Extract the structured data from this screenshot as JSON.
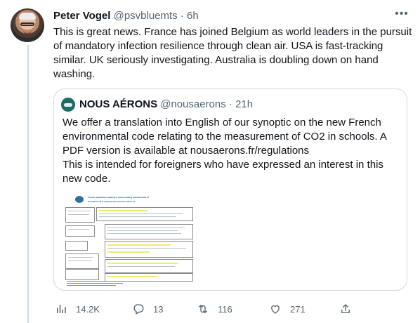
{
  "tweet": {
    "author_name": "Peter Vogel",
    "handle_time": "@psvbluemts · 6h",
    "text": "This is great news.  France has joined Belgium as world leaders in the pursuit of mandatory infection resilience through clean air. USA is fast-tracking similar. UK seriously investigating. Australia is doubling down on hand washing."
  },
  "quoted": {
    "author_name": "NOUS AÉRONS",
    "handle_time": "@nousaerons · 21h",
    "line1": "We offer a translation into English of our synoptic on the new French environmental code relating to the measurement of CO2 in schools. A PDF version is available at nousaerons.fr/regulations",
    "line2": "This is intended for foreigners who have expressed an interest in this new code.",
    "doc_title_1": "French regulations relating to direct reading measurement of",
    "doc_title_2": "the CO2 level in daycare and schools indoor air"
  },
  "actions": {
    "views": "14.2K",
    "replies": "13",
    "retweets": "116",
    "likes": "271"
  },
  "icons": {
    "more": "more-icon",
    "views": "views-icon",
    "reply": "reply-icon",
    "retweet": "retweet-icon",
    "like": "like-icon",
    "share": "share-icon"
  },
  "colors": {
    "muted": "#536471",
    "border": "#cfd9de",
    "text": "#0f1419"
  }
}
